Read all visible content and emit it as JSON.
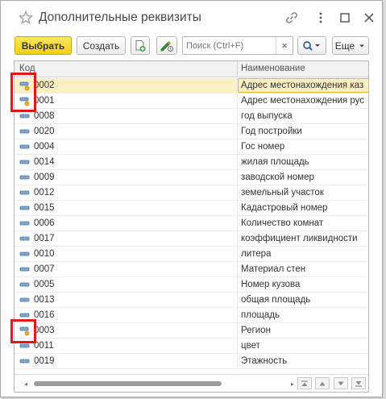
{
  "window": {
    "title": "Дополнительные реквизиты"
  },
  "titlebar_icons": [
    "star-icon",
    "link-icon",
    "more-vertical-icon",
    "maximize-icon",
    "close-icon"
  ],
  "toolbar": {
    "select_label": "Выбрать",
    "create_label": "Создать",
    "search_placeholder": "Поиск (Ctrl+F)",
    "search_clear": "×",
    "more_label": "Еще",
    "accent_color": "#f5d52a"
  },
  "table": {
    "columns": [
      "Код",
      "Наименование"
    ],
    "rows": [
      {
        "code": "0002",
        "name": "Адрес местонахождения каз",
        "icon": "attribute-icon-marked",
        "selected": true
      },
      {
        "code": "0001",
        "name": "Адрес местонахождения рус",
        "icon": "attribute-icon-marked",
        "selected": false
      },
      {
        "code": "0008",
        "name": "год выпуска",
        "icon": "attribute-icon",
        "selected": false
      },
      {
        "code": "0020",
        "name": "Год постройки",
        "icon": "attribute-icon",
        "selected": false
      },
      {
        "code": "0004",
        "name": "Гос номер",
        "icon": "attribute-icon",
        "selected": false
      },
      {
        "code": "0014",
        "name": "жилая площадь",
        "icon": "attribute-icon",
        "selected": false
      },
      {
        "code": "0009",
        "name": "заводской номер",
        "icon": "attribute-icon",
        "selected": false
      },
      {
        "code": "0012",
        "name": "земельный участок",
        "icon": "attribute-icon",
        "selected": false
      },
      {
        "code": "0015",
        "name": "Кадастровый номер",
        "icon": "attribute-icon",
        "selected": false
      },
      {
        "code": "0006",
        "name": "Количество комнат",
        "icon": "attribute-icon",
        "selected": false
      },
      {
        "code": "0017",
        "name": "коэффициент ликвидности",
        "icon": "attribute-icon",
        "selected": false
      },
      {
        "code": "0010",
        "name": "литера",
        "icon": "attribute-icon",
        "selected": false
      },
      {
        "code": "0007",
        "name": "Материал стен",
        "icon": "attribute-icon",
        "selected": false
      },
      {
        "code": "0005",
        "name": "Номер кузова",
        "icon": "attribute-icon",
        "selected": false
      },
      {
        "code": "0013",
        "name": "общая площадь",
        "icon": "attribute-icon",
        "selected": false
      },
      {
        "code": "0016",
        "name": "площадь",
        "icon": "attribute-icon",
        "selected": false
      },
      {
        "code": "0003",
        "name": "Регион",
        "icon": "attribute-icon-marked",
        "selected": false
      },
      {
        "code": "0011",
        "name": "цвет",
        "icon": "attribute-icon",
        "selected": false
      },
      {
        "code": "0019",
        "name": "Этажность",
        "icon": "attribute-icon",
        "selected": false
      }
    ]
  },
  "highlight_color": "#e2171b",
  "footer": {
    "scroll_left": "◂",
    "scroll_right": "▸",
    "nav_icons": [
      "first-page-icon",
      "up-icon",
      "down-icon",
      "last-page-icon"
    ]
  }
}
